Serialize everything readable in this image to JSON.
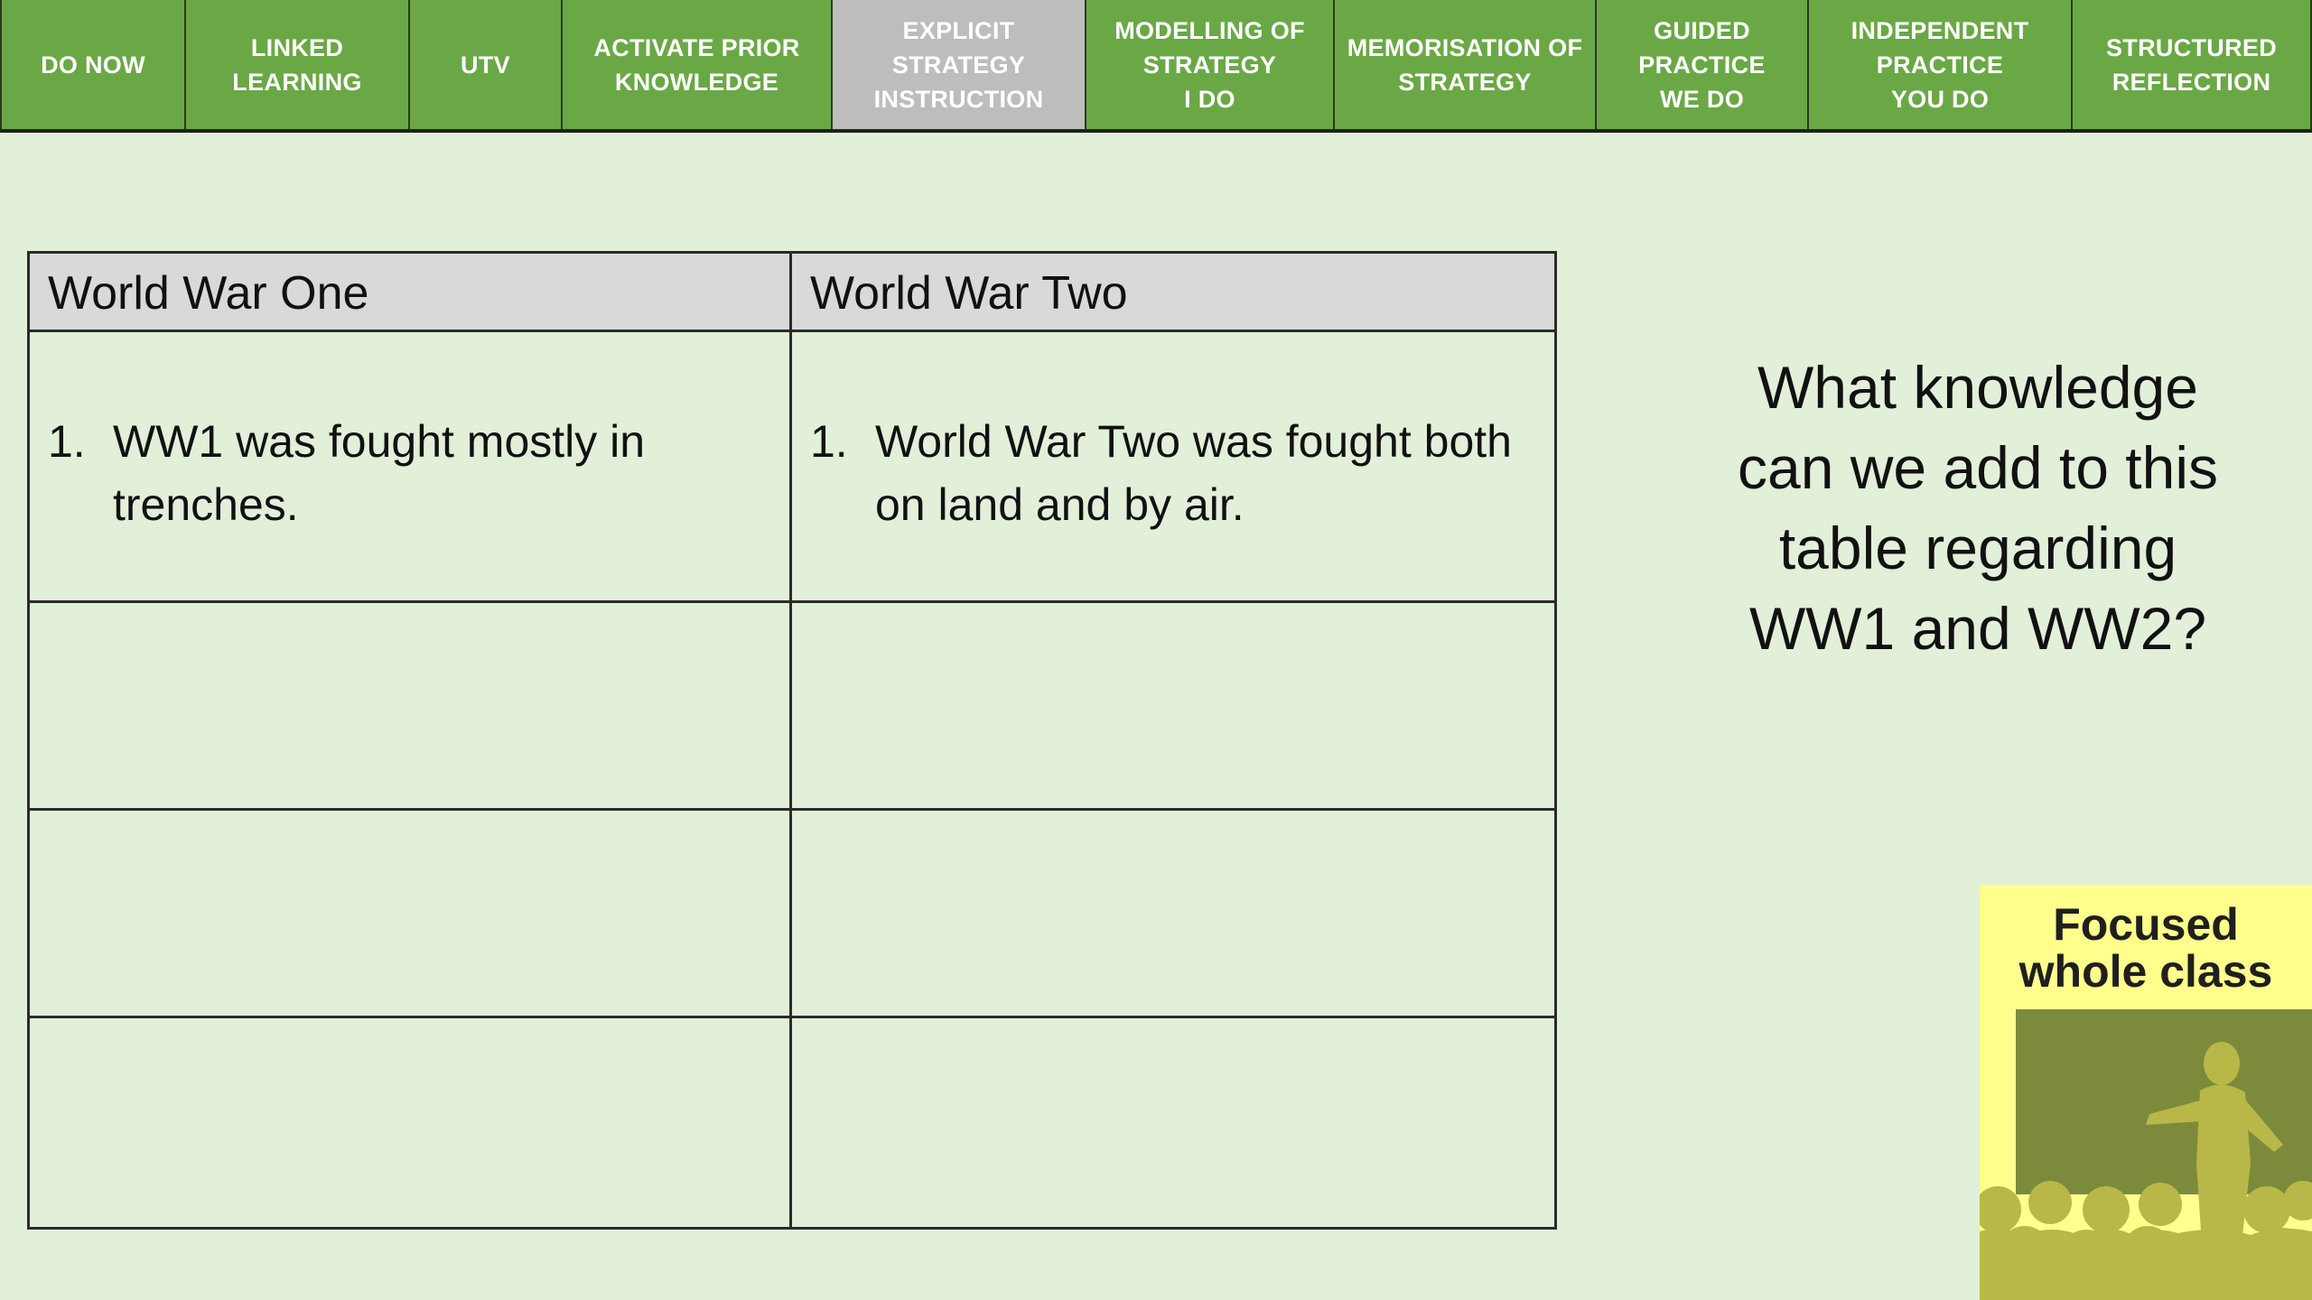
{
  "nav": {
    "tabs": [
      {
        "label": "DO NOW",
        "active": false
      },
      {
        "label": "LINKED\nLEARNING",
        "active": false
      },
      {
        "label": "UTV",
        "active": false
      },
      {
        "label": "ACTIVATE PRIOR\nKNOWLEDGE",
        "active": false
      },
      {
        "label": "EXPLICIT\nSTRATEGY\nINSTRUCTION",
        "active": true
      },
      {
        "label": "MODELLING OF\nSTRATEGY\nI DO",
        "active": false
      },
      {
        "label": "MEMORISATION OF\nSTRATEGY",
        "active": false
      },
      {
        "label": "GUIDED\nPRACTICE\nWE DO",
        "active": false
      },
      {
        "label": "INDEPENDENT\nPRACTICE\nYOU DO",
        "active": false
      },
      {
        "label": "STRUCTURED\nREFLECTION",
        "active": false
      }
    ]
  },
  "table": {
    "headers": [
      "World War One",
      "World War Two"
    ],
    "rows": [
      [
        {
          "num": "1.",
          "text": "WW1 was fought mostly in trenches."
        },
        {
          "num": "1.",
          "text": "World War Two was fought both on land and by air."
        }
      ]
    ]
  },
  "question": "What knowledge\ncan we add to this\ntable regarding\nWW1 and WW2?",
  "badge": {
    "title": "Focused\nwhole class",
    "colors": {
      "background": "#ffff8c",
      "art": "#b8b848",
      "screen": "#7c8a3c"
    }
  },
  "colors": {
    "background": "#e2efd9",
    "tab": "#6aa846",
    "tab_active": "#bdbdbd",
    "table_header": "#d9d9d9"
  }
}
